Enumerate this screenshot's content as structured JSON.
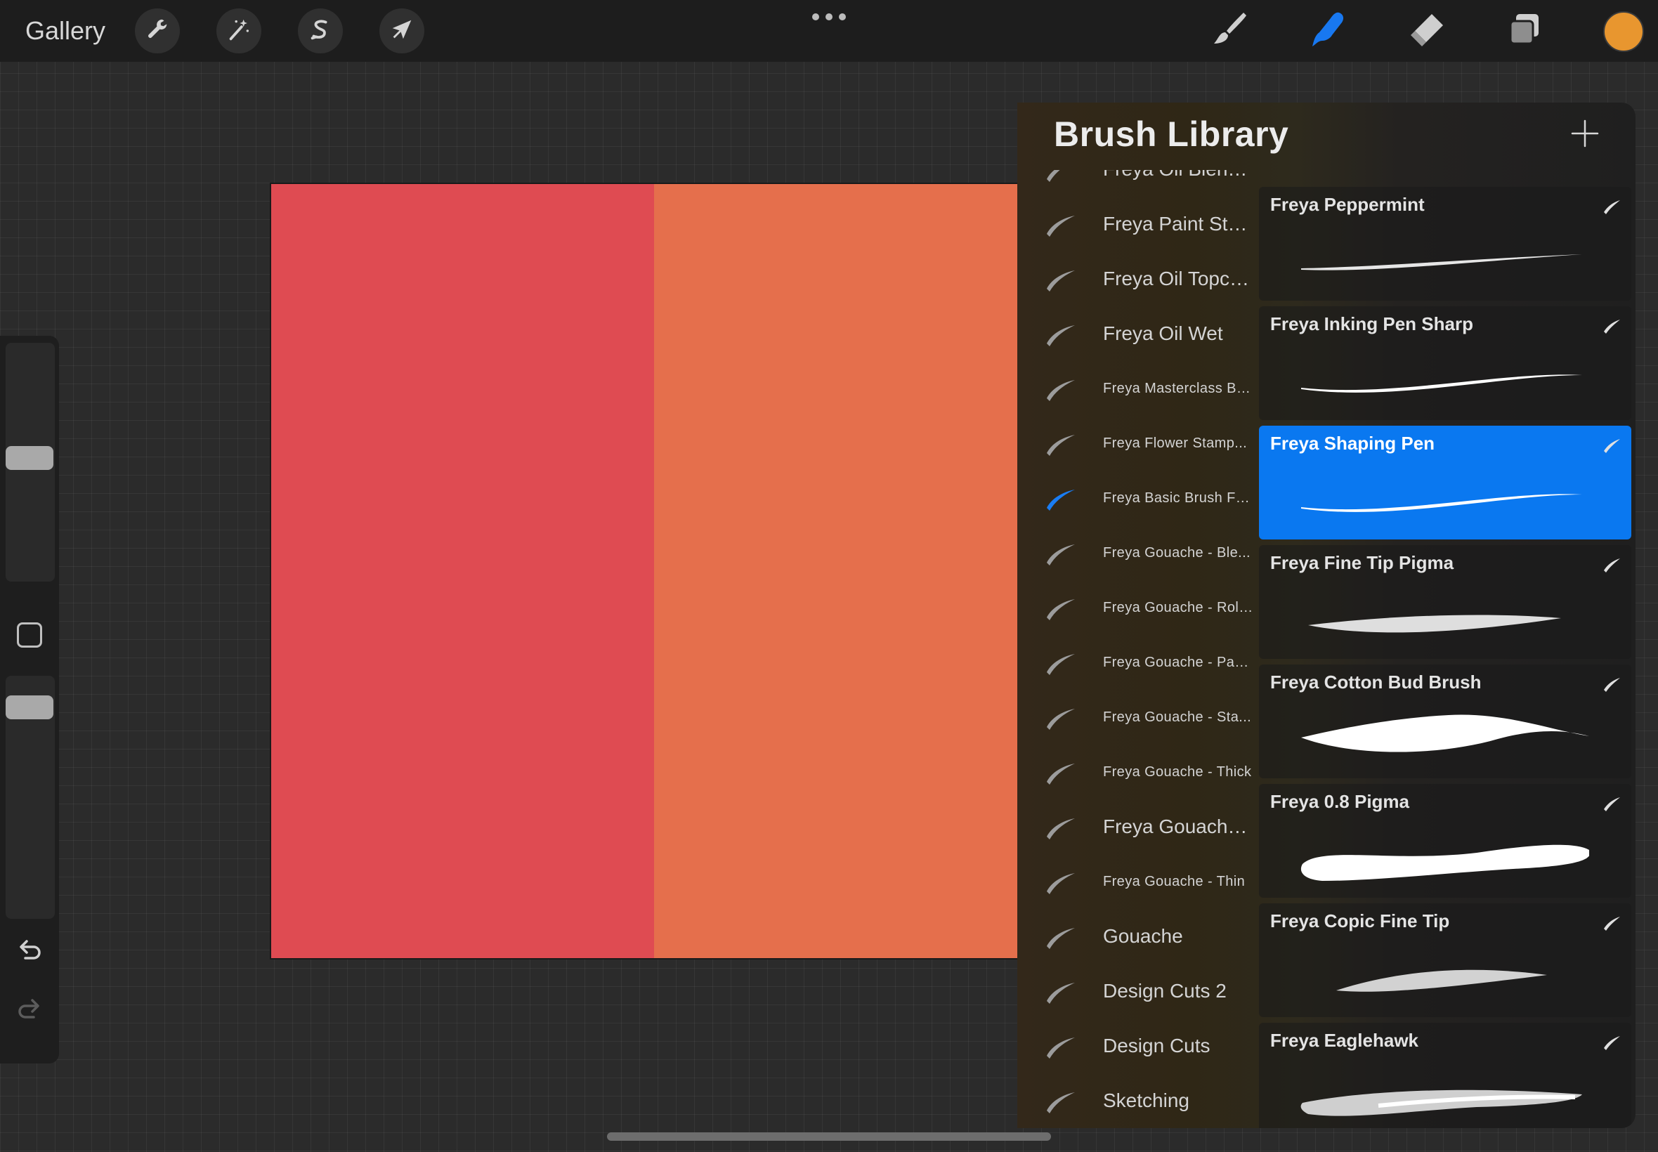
{
  "topbar": {
    "gallery_label": "Gallery",
    "tools": [
      {
        "name": "actions",
        "icon": "wrench-icon"
      },
      {
        "name": "adjustments",
        "icon": "magic-wand-icon"
      },
      {
        "name": "selection",
        "icon": "selection-s-icon"
      },
      {
        "name": "transform",
        "icon": "arrow-cursor-icon"
      }
    ],
    "right_tools": [
      {
        "name": "paint",
        "icon": "brush-icon",
        "active": false
      },
      {
        "name": "smudge",
        "icon": "smudge-finger-icon",
        "active": true
      },
      {
        "name": "erase",
        "icon": "eraser-icon",
        "active": false
      },
      {
        "name": "layers",
        "icon": "layers-icon",
        "active": false
      }
    ],
    "current_color": "#e8962f"
  },
  "canvas": {
    "left_color": "#df4b52",
    "right_color": "#e56f4c"
  },
  "library": {
    "title": "Brush Library",
    "add_icon": "plus-icon",
    "sets": [
      {
        "label": "Freya Oil Blender",
        "size": "big",
        "selected": false
      },
      {
        "label": "Freya Paint Stamp",
        "size": "big",
        "selected": false
      },
      {
        "label": "Freya Oil Topcoat",
        "size": "big",
        "selected": false
      },
      {
        "label": "Freya Oil Wet",
        "size": "big",
        "selected": false
      },
      {
        "label": "Freya Masterclass Bo...",
        "size": "small",
        "selected": false
      },
      {
        "label": "Freya Flower Stamp...",
        "size": "small",
        "selected": false
      },
      {
        "label": "Freya Basic Brush Fu...",
        "size": "small",
        "selected": true
      },
      {
        "label": "Freya Gouache - Ble...",
        "size": "small",
        "selected": false
      },
      {
        "label": "Freya Gouache - Rolli...",
        "size": "small",
        "selected": false
      },
      {
        "label": "Freya Gouache - Paper",
        "size": "small",
        "selected": false
      },
      {
        "label": "Freya Gouache - Sta...",
        "size": "small",
        "selected": false
      },
      {
        "label": "Freya Gouache - Thick",
        "size": "small",
        "selected": false
      },
      {
        "label": "Freya Gouache - Tip",
        "size": "big",
        "selected": false
      },
      {
        "label": "Freya Gouache - Thin",
        "size": "small",
        "selected": false
      },
      {
        "label": "Gouache",
        "size": "big",
        "selected": false
      },
      {
        "label": "Design Cuts 2",
        "size": "big",
        "selected": false
      },
      {
        "label": "Design Cuts",
        "size": "big",
        "selected": false
      },
      {
        "label": "Sketching",
        "size": "big",
        "selected": false
      }
    ],
    "brushes": [
      {
        "name": "Freya Peppermint",
        "stroke": "thin-taper",
        "selected": false
      },
      {
        "name": "Freya Inking Pen Sharp",
        "stroke": "ink-line",
        "selected": false
      },
      {
        "name": "Freya Shaping Pen",
        "stroke": "ink-line",
        "selected": true
      },
      {
        "name": "Freya Fine Tip Pigma",
        "stroke": "textured-leaf",
        "selected": false
      },
      {
        "name": "Freya Cotton Bud Brush",
        "stroke": "solid-leaf",
        "selected": false
      },
      {
        "name": "Freya 0.8 Pigma",
        "stroke": "rough-wide",
        "selected": false
      },
      {
        "name": "Freya Copic Fine Tip",
        "stroke": "textured-small",
        "selected": false
      },
      {
        "name": "Freya Eaglehawk",
        "stroke": "dry-brush",
        "selected": false
      }
    ]
  }
}
